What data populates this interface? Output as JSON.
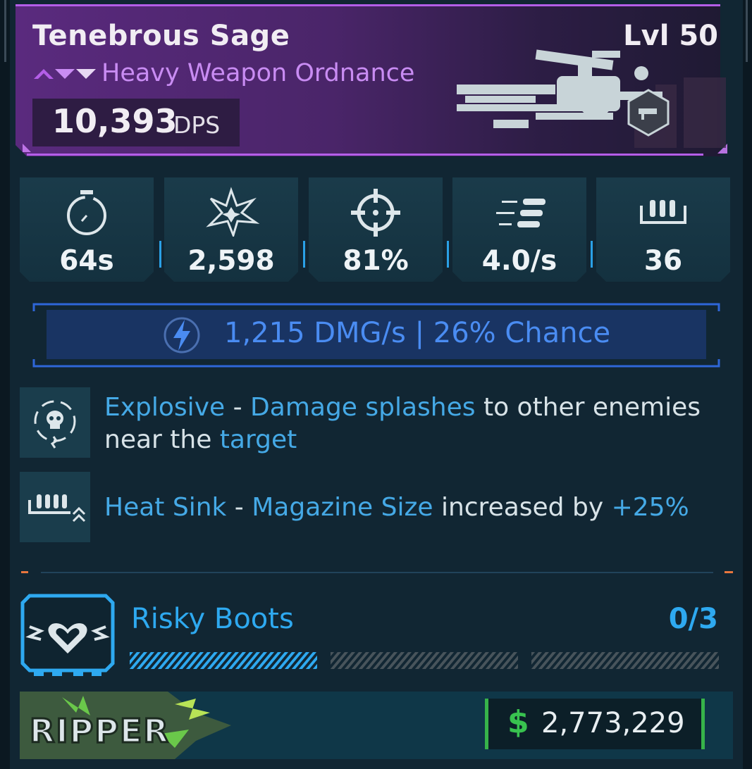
{
  "weapon": {
    "name": "Tenebrous Sage",
    "level": "Lvl 50",
    "type": "Heavy Weapon Ordnance",
    "type_icon": "rarity-chevrons-icon",
    "dps_value": "10,393",
    "dps_unit": "DPS",
    "image": "rocket-launcher-weapon-image",
    "class_badge": "rocket-launcher-badge-icon",
    "rarity_color": "#b45ee8"
  },
  "stats": [
    {
      "icon": "reload-timer-icon",
      "value": "64s"
    },
    {
      "icon": "damage-burst-icon",
      "value": "2,598"
    },
    {
      "icon": "crosshair-accuracy-icon",
      "value": "81%"
    },
    {
      "icon": "fire-rate-bullets-icon",
      "value": "4.0/s"
    },
    {
      "icon": "magazine-icon",
      "value": "36"
    }
  ],
  "elemental": {
    "icon": "shock-lightning-icon",
    "text": "1,215 DMG/s | 26% Chance",
    "color": "#4a8cf2"
  },
  "perks": [
    {
      "icon": "explosive-skull-icon",
      "name": "Explosive",
      "sep": " - ",
      "h1": "Damage splashes",
      "t1": " to other enemies near the ",
      "h2": "target",
      "t2": ""
    },
    {
      "icon": "magazine-upgrade-icon",
      "name": "Heat Sink",
      "sep": " - ",
      "h1": "Magazine Size",
      "t1": " increased by ",
      "h2": "+25%",
      "t2": ""
    }
  ],
  "set": {
    "icon": "winged-heart-icon",
    "name": "Risky Boots",
    "count": "0/3",
    "progress": 0,
    "segments": 3,
    "color": "#2ea9f0"
  },
  "footer": {
    "brand": "RIPPER",
    "currency_symbol": "$",
    "price": "2,773,229",
    "currency_color": "#38c24f"
  }
}
